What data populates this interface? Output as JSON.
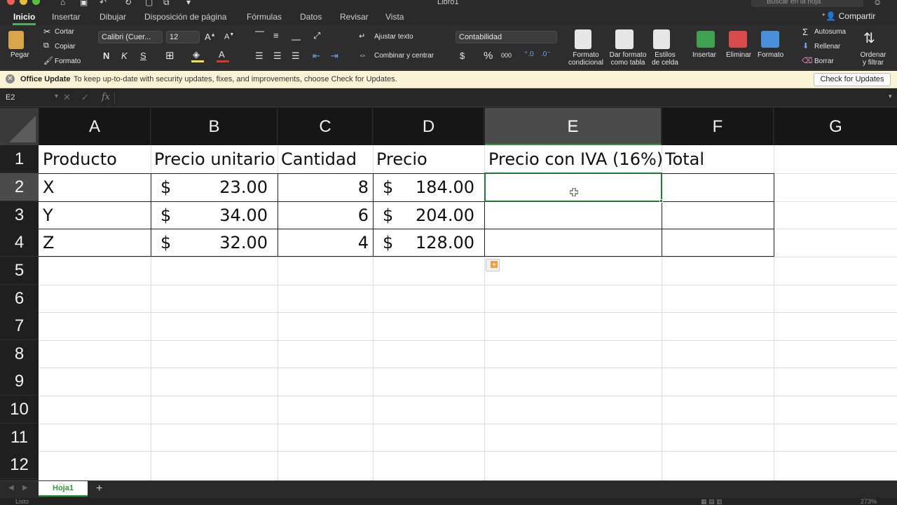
{
  "window": {
    "title": "Libro1",
    "search_placeholder": "Buscar en la hoja"
  },
  "tabs": [
    {
      "label": "Inicio"
    },
    {
      "label": "Insertar"
    },
    {
      "label": "Dibujar"
    },
    {
      "label": "Disposición de página"
    },
    {
      "label": "Fórmulas"
    },
    {
      "label": "Datos"
    },
    {
      "label": "Revisar"
    },
    {
      "label": "Vista"
    }
  ],
  "share_label": "Compartir",
  "ribbon": {
    "paste": "Pegar",
    "cut": "Cortar",
    "copy": "Copiar",
    "format_painter": "Formato",
    "font_name": "Calibri (Cuer...",
    "font_size": "12",
    "bold": "N",
    "italic": "K",
    "underline": "S",
    "wrap_text": "Ajustar texto",
    "merge_center": "Combinar y centrar",
    "number_format": "Contabilidad",
    "currency": "$",
    "percent": "%",
    "thousands": "000",
    "cond_format": "Formato\ncondicional",
    "format_table": "Dar formato\ncomo tabla",
    "cell_styles": "Estilos\nde celda",
    "insert": "Insertar",
    "delete": "Eliminar",
    "format": "Formato",
    "autosum": "Autosuma",
    "fill": "Rellenar",
    "clear": "Borrar",
    "sort_filter": "Ordenar\ny filtrar"
  },
  "notification": {
    "title": "Office Update",
    "message": "To keep up-to-date with security updates, fixes, and improvements, choose Check for Updates.",
    "button": "Check for Updates"
  },
  "formula_bar": {
    "name_box": "E2",
    "fx": "fx",
    "value": ""
  },
  "grid": {
    "columns": [
      "A",
      "B",
      "C",
      "D",
      "E",
      "F",
      "G"
    ],
    "selected_column": "E",
    "selected_row": "2",
    "rows": [
      "1",
      "2",
      "3",
      "4",
      "5",
      "6",
      "7",
      "8",
      "9",
      "10",
      "11",
      "12"
    ],
    "header_row": [
      "Producto",
      "Precio unitario",
      "Cantidad",
      "Precio",
      "Precio con IVA (16%)",
      "Total"
    ],
    "data": [
      {
        "producto": "X",
        "precio_unitario": "23.00",
        "cantidad": "8",
        "precio": "184.00"
      },
      {
        "producto": "Y",
        "precio_unitario": "34.00",
        "cantidad": "6",
        "precio": "204.00"
      },
      {
        "producto": "Z",
        "precio_unitario": "32.00",
        "cantidad": "4",
        "precio": "128.00"
      }
    ],
    "currency_symbol": "$"
  },
  "sheets": [
    {
      "label": "Hoja1"
    }
  ],
  "add_sheet": "+",
  "status": {
    "text": "Listo",
    "zoom": "273%"
  }
}
